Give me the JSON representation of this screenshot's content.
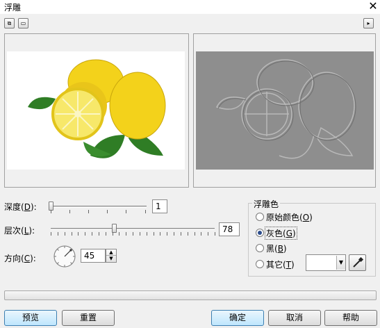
{
  "window": {
    "title": "浮雕"
  },
  "toolbar": {
    "left_icon_a": "split-preview-icon",
    "left_icon_b": "single-preview-icon",
    "right_icon": "play-arrow-icon"
  },
  "controls": {
    "depth": {
      "label_prefix": "深度(",
      "key": "D",
      "label_suffix": "):",
      "value": "1",
      "slider_fraction": 0.0
    },
    "level": {
      "label_prefix": "层次(",
      "key": "L",
      "label_suffix": "):",
      "value": "78",
      "slider_fraction": 0.39
    },
    "direction": {
      "label_prefix": "方向(",
      "key": "C",
      "label_suffix": "):",
      "value": "45"
    }
  },
  "emboss_color": {
    "group_label": "浮雕色",
    "options": [
      {
        "text": "原始颜色(",
        "key": "O",
        "suffix": ")",
        "selected": false
      },
      {
        "text": "灰色(",
        "key": "G",
        "suffix": ")",
        "selected": true
      },
      {
        "text": "黑(",
        "key": "B",
        "suffix": ")",
        "selected": false
      },
      {
        "text": "其它(",
        "key": "T",
        "suffix": ")",
        "selected": false
      }
    ]
  },
  "buttons": {
    "preview": "预览",
    "reset": "重置",
    "ok": "确定",
    "cancel": "取消",
    "help": "帮助"
  },
  "colors": {
    "lemon": "#f3d21b",
    "leaf": "#2f7d25",
    "emboss_gray": "#8e8e8e",
    "accent": "#3c7fb1"
  }
}
